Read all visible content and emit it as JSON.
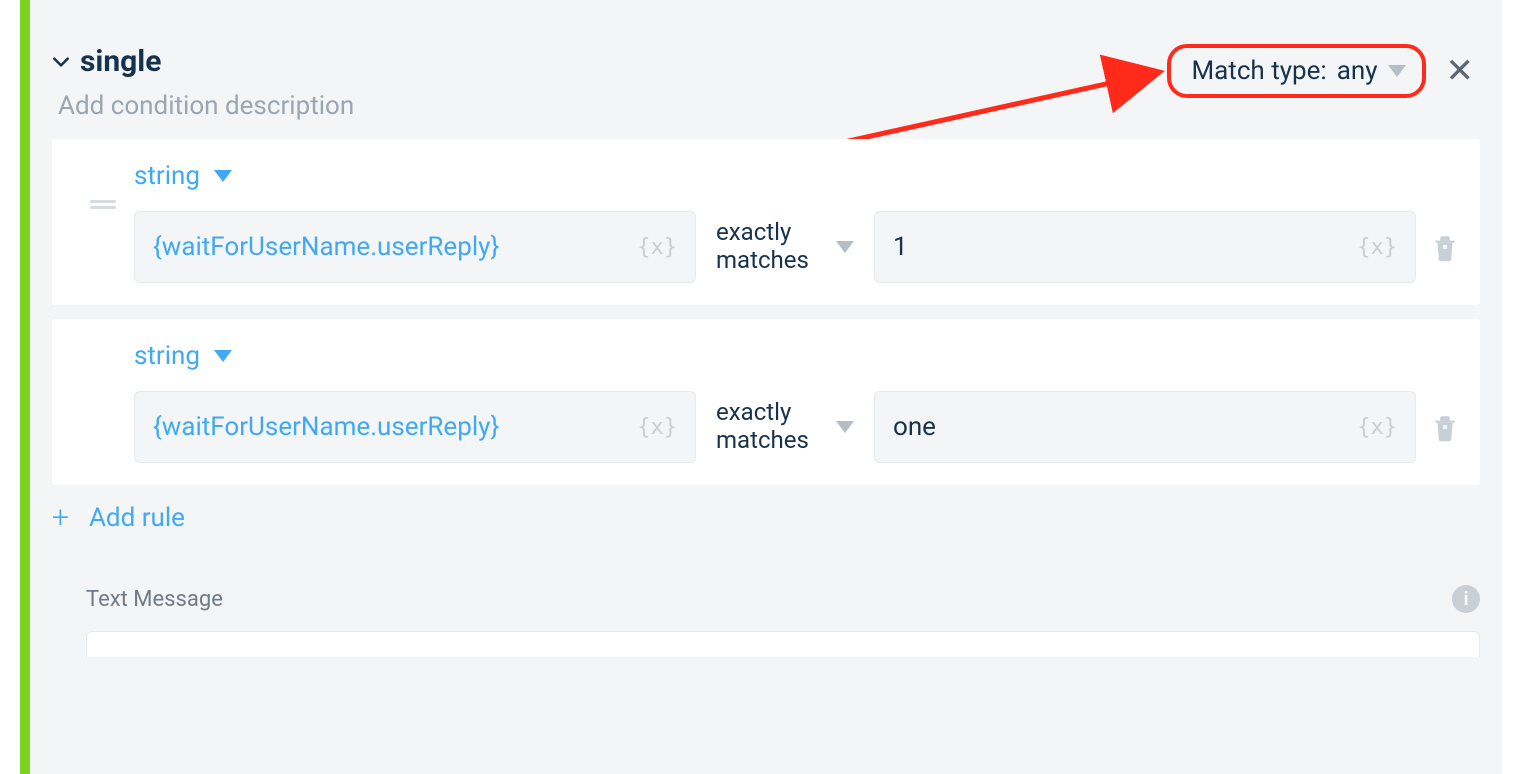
{
  "header": {
    "title": "single",
    "subtitle_placeholder": "Add condition description",
    "match_type_label": "Match type:",
    "match_type_value": "any"
  },
  "rules": [
    {
      "type": "string",
      "left": "{waitForUserName.userReply}",
      "operator": "exactly matches",
      "right": "1"
    },
    {
      "type": "string",
      "left": "{waitForUserName.userReply}",
      "operator": "exactly matches",
      "right": "one"
    }
  ],
  "add_rule_label": "Add rule",
  "action": {
    "label": "Text Message"
  },
  "glyphs": {
    "var_badge": "{x}",
    "close": "✕",
    "info": "i",
    "plus": "+"
  },
  "annotation": {
    "note": "Red rounded box and arrow highlight the Match-type selector"
  }
}
